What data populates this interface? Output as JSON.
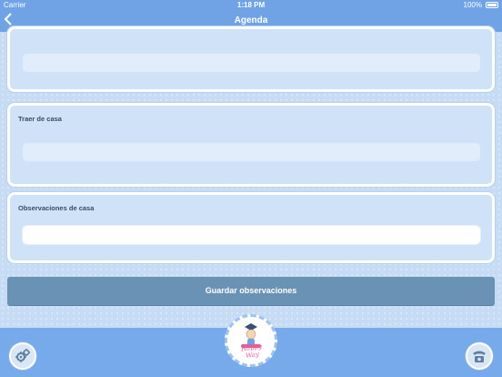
{
  "status_bar": {
    "carrier": "Carrier",
    "time": "1:18 PM",
    "battery": "100%"
  },
  "nav": {
    "back_icon": "chevron-left-icon",
    "title": "Agenda"
  },
  "cards": [
    {
      "label": "",
      "field_value": ""
    },
    {
      "label": "Traer de casa",
      "field_value": ""
    },
    {
      "label": "Observaciones de casa",
      "field_value": ""
    }
  ],
  "save_button": {
    "label": "Guardar observaciones"
  },
  "footer": {
    "settings_icon": "gears-icon",
    "logo_text": "Happy Way",
    "phone_icon": "telephone-icon"
  },
  "colors": {
    "nav": "#6fa3e6",
    "background": "#c6dcf4",
    "button": "#6a92b5",
    "footer": "#76aaea"
  }
}
